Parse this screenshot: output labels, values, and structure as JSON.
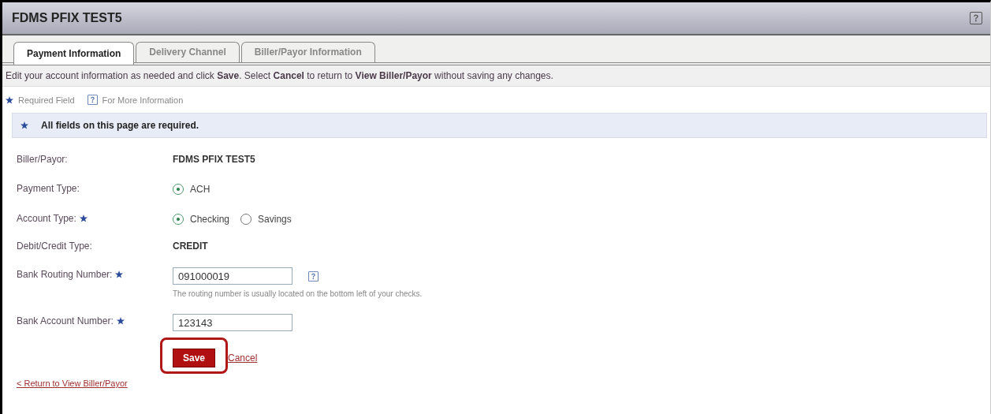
{
  "window": {
    "title": "FDMS PFIX TEST5",
    "help": true
  },
  "tabs": [
    {
      "label": "Payment Information",
      "selected": true
    },
    {
      "label": "Delivery Channel",
      "selected": false
    },
    {
      "label": "Biller/Payor Information",
      "selected": false
    }
  ],
  "instructions": "Edit your account information as needed and click **Save**. Select **Cancel** to return to **View Biller/Payor** without saving any changes.",
  "legend": [
    {
      "kind": "required",
      "label": "Required Field"
    },
    {
      "kind": "help",
      "label": "For More Information"
    }
  ],
  "notice": "All fields on this page are required.",
  "fields": [
    {
      "kind": "text",
      "label": "Biller/Payor:",
      "required": false,
      "value": "FDMS PFIX TEST5"
    },
    {
      "kind": "radio",
      "label": "Payment Type:",
      "required": false,
      "options": [
        {
          "label": "ACH",
          "selected": true
        }
      ]
    },
    {
      "kind": "radio",
      "label": "Account Type:",
      "required": true,
      "options": [
        {
          "label": "Checking",
          "selected": true
        },
        {
          "label": "Savings",
          "selected": false
        }
      ]
    },
    {
      "kind": "text",
      "label": "Debit/Credit Type:",
      "required": false,
      "value": "CREDIT"
    },
    {
      "kind": "input",
      "label": "Bank Routing Number:",
      "required": true,
      "value": "091000019",
      "help": true,
      "hint": "The routing number is usually located on the bottom left of your checks."
    },
    {
      "kind": "input",
      "label": "Bank Account Number:",
      "required": true,
      "value": "123143",
      "help": false
    }
  ],
  "actions": {
    "save": "Save",
    "cancel": "Cancel",
    "highlighted": true
  },
  "back_link": "< Return to View Biller/Payor"
}
